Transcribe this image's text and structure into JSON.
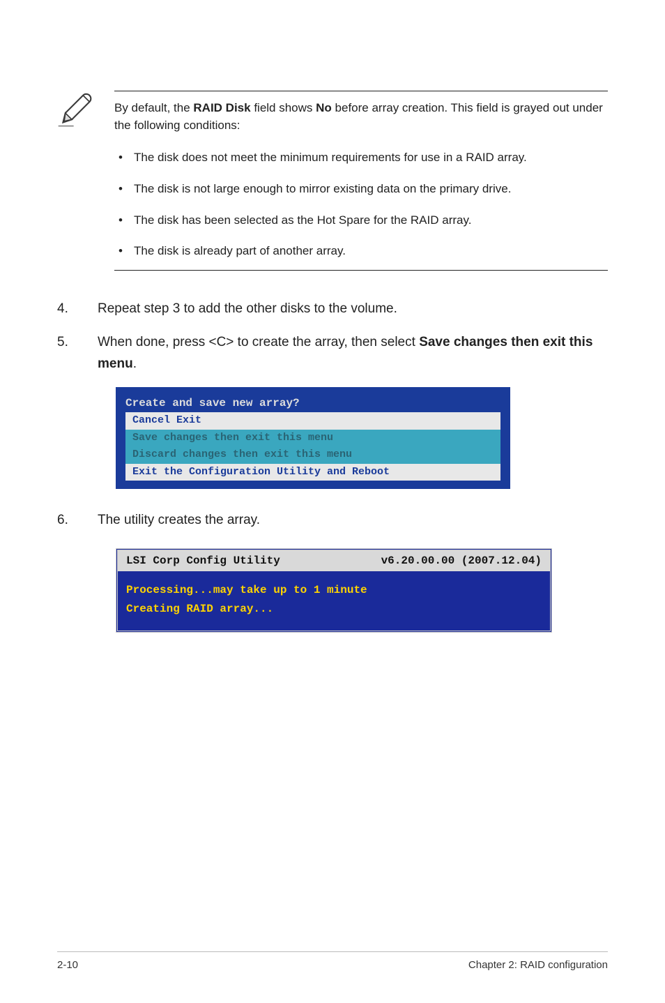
{
  "note": {
    "intro_a": "By default, the ",
    "bold1": "RAID Disk",
    "intro_b": " field shows ",
    "bold2": "No",
    "intro_c": " before array creation. This field is grayed out under the following conditions:",
    "bullets": [
      "The disk does not meet the minimum requirements for use in a RAID array.",
      "The disk is not large enough to mirror existing data on the primary drive.",
      "The disk has been selected as the Hot Spare for the RAID array.",
      "The disk is already part of another array."
    ]
  },
  "steps": {
    "s4": {
      "n": "4.",
      "t": "Repeat step 3 to add the other disks to the volume."
    },
    "s5": {
      "n": "5.",
      "a": "When done, press <C> to create the array, then select ",
      "b": "Save changes then exit this menu",
      "c": "."
    },
    "s6": {
      "n": "6.",
      "t": "The utility creates the array."
    }
  },
  "bios1": {
    "title": "Create and save new array?",
    "items": [
      "Cancel Exit",
      "Save changes then exit this menu",
      "Discard changes then exit this menu",
      "Exit the Configuration Utility and Reboot"
    ]
  },
  "bios2": {
    "app": "LSI Corp Config Utility",
    "ver": "v6.20.00.00 (2007.12.04)",
    "l1": "Processing...may take up to 1 minute",
    "l2": "Creating RAID array..."
  },
  "footer": {
    "left": "2-10",
    "right": "Chapter 2: RAID configuration"
  }
}
